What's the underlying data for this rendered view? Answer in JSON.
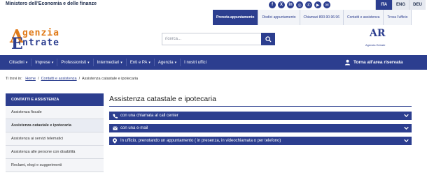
{
  "topbar": {
    "ministry": "Ministero dell'Economia e delle finanze",
    "social": [
      {
        "icon": "facebook-icon",
        "glyph": "f"
      },
      {
        "icon": "x-icon",
        "glyph": "X"
      },
      {
        "icon": "linkedin-icon",
        "glyph": "in"
      },
      {
        "icon": "instagram-icon",
        "glyph": "◎"
      },
      {
        "icon": "whatsapp-icon",
        "glyph": "✆"
      },
      {
        "icon": "youtube-icon",
        "glyph": "▶"
      },
      {
        "icon": "mail-icon",
        "glyph": "✉"
      }
    ],
    "languages": [
      "ITA",
      "ENG",
      "DEU"
    ],
    "active_language": "ITA"
  },
  "links": [
    {
      "label": "Prenota appuntamento",
      "primary": true
    },
    {
      "label": "Disdici appuntamento",
      "primary": false
    },
    {
      "label": "Chiamaci 800.90.96.96",
      "primary": false
    },
    {
      "label": "Contatti e assistenza",
      "primary": false
    },
    {
      "label": "Trova l'ufficio",
      "primary": false
    }
  ],
  "logo": {
    "line1": "genzia",
    "line2": "ntrate",
    "big_a": "A",
    "big_e": "E"
  },
  "search": {
    "placeholder": "ricerca..."
  },
  "brand2": {
    "mark": "AR",
    "text": "Agenzia Entrate"
  },
  "nav": {
    "items": [
      "Cittadini",
      "Imprese",
      "Professionisti",
      "Intermediari",
      "Enti e PA",
      "Agenzia",
      "I nostri uffici"
    ],
    "area_label": "Torna all'area riservata"
  },
  "breadcrumb": {
    "prefix": "Ti trovi in:",
    "home": "Home",
    "contatti": "Contatti e assistenza",
    "current": "Assistenza catastale e ipotecaria"
  },
  "sidebar": {
    "heading": "CONTATTI E ASSISTENZA",
    "items": [
      "Assistenza fiscale",
      "Assistenza catastale e ipotecaria",
      "Assistenza ai servizi telematici",
      "Assistenza alle persone con disabilità",
      "Reclami, elogi e suggerimenti"
    ],
    "active_index": 1
  },
  "content": {
    "title": "Assistenza catastale e ipotecaria",
    "accordions": [
      {
        "label": "con una chiamata al call center",
        "icon": "phone-icon"
      },
      {
        "label": "con una e-mail",
        "icon": "envelope-icon"
      },
      {
        "label": "In ufficio, prenotando un appuntamento ( in presenza, in videochiamata o per telefono)",
        "icon": "location-pin-icon"
      }
    ]
  },
  "colors": {
    "brand_blue": "#2c3e8f",
    "brand_orange": "#e07b1a"
  }
}
